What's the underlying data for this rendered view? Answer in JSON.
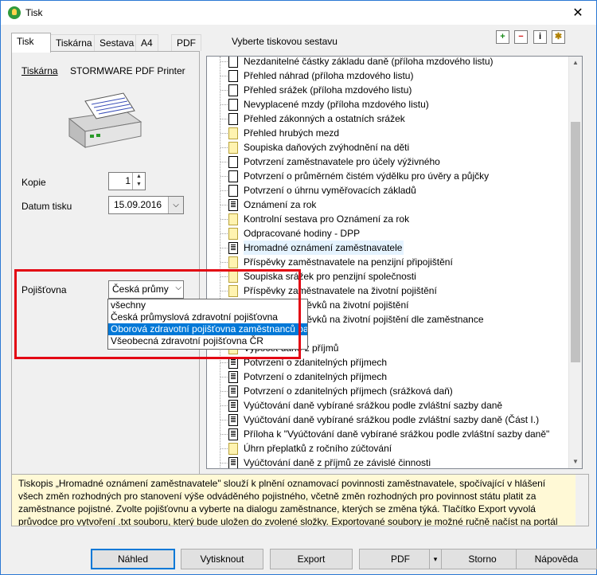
{
  "window": {
    "title": "Tisk",
    "close": "✕"
  },
  "tabs": [
    "Tisk",
    "Tiskárna",
    "Sestava",
    "A4",
    "PDF"
  ],
  "sestava_label": "Vyberte tiskovou sestavu",
  "toolbar_icons": [
    "add-icon",
    "remove-icon",
    "info-icon",
    "settings-icon"
  ],
  "left": {
    "printer_label": "Tiskárna",
    "printer_name": "STORMWARE PDF Printer",
    "kopie_label": "Kopie",
    "kopie_value": "1",
    "datum_label": "Datum tisku",
    "datum_value": "15.09.2016",
    "pojistovna_label": "Pojišťovna",
    "pojistovna_value": "Česká průmy",
    "dropdown": [
      "všechny",
      "Česká průmyslová zdravotní pojišťovna",
      "Oborová zdravotní pojišťovna zaměstnanců ba",
      "Všeobecná zdravotní pojišťovna ČR"
    ],
    "dropdown_selected": 2
  },
  "tree": [
    {
      "t": "Nezdanitelné částky základu daně (příloha mzdového listu)",
      "i": "doc"
    },
    {
      "t": "Přehled náhrad (příloha mzdového listu)",
      "i": "doc"
    },
    {
      "t": "Přehled srážek (příloha mzdového listu)",
      "i": "doc"
    },
    {
      "t": "Nevyplacené mzdy (příloha mzdového listu)",
      "i": "doc"
    },
    {
      "t": "Přehled zákonných a ostatních srážek",
      "i": "doc"
    },
    {
      "t": "Přehled hrubých mezd",
      "i": "folder"
    },
    {
      "t": "Soupiska daňových zvýhodnění na děti",
      "i": "folder"
    },
    {
      "t": "Potvrzení zaměstnavatele pro účely výživného",
      "i": "doc"
    },
    {
      "t": "Potvrzení o průměrném čistém výdělku pro úvěry a půjčky",
      "i": "doc"
    },
    {
      "t": "Potvrzení o úhrnu vyměřovacích základů",
      "i": "doc"
    },
    {
      "t": "Oznámení za rok",
      "i": "lines"
    },
    {
      "t": "Kontrolní sestava pro Oznámení za rok",
      "i": "folder"
    },
    {
      "t": "Odpracované hodiny - DPP",
      "i": "folder"
    },
    {
      "t": "Hromadné oznámení zaměstnavatele",
      "i": "lines",
      "hl": true
    },
    {
      "t": "Příspěvky zaměstnavatele na penzijní připojištění",
      "i": "folder"
    },
    {
      "t": "Soupiska srážek pro penzijní společnosti",
      "i": "folder"
    },
    {
      "t": "Příspěvky zaměstnavatele na životní pojištění",
      "i": "folder"
    },
    {
      "t": "Soupiska příspěvků na životní pojištění",
      "i": "folder"
    },
    {
      "t": "Soupiska příspěvků na životní pojištění dle zaměstnance",
      "i": "folder"
    },
    {
      "t": "",
      "i": "none"
    },
    {
      "t": "Výpočet daně z příjmů",
      "i": "folder"
    },
    {
      "t": "Potvrzení o zdanitelných příjmech",
      "i": "lines"
    },
    {
      "t": "Potvrzení o zdanitelných příjmech",
      "i": "lines"
    },
    {
      "t": "Potvrzení o zdanitelných příjmech (srážková daň)",
      "i": "lines"
    },
    {
      "t": "Vyúčtování daně vybírané srážkou podle zvláštní sazby daně",
      "i": "lines"
    },
    {
      "t": "Vyúčtování daně vybírané srážkou podle zvláštní sazby daně (Část I.)",
      "i": "lines"
    },
    {
      "t": "Příloha k \"Vyúčtování daně vybírané srážkou podle zvláštní sazby daně\"",
      "i": "lines"
    },
    {
      "t": "Úhrn přeplatků z ročního zúčtování",
      "i": "folder"
    },
    {
      "t": "Vyúčtování daně z příjmů ze závislé činnosti",
      "i": "lines"
    }
  ],
  "description": "Tiskopis „Hromadné oznámení zaměstnavatele\" slouží k plnění oznamovací povinnosti zaměstnavatele, spočívající v hlášení všech změn rozhodných pro stanovení výše odváděného pojistného, včetně změn rozhodných pro povinnost státu platit za zaměstnance pojistné. Zvolte pojišťovnu a vyberte na dialogu zaměstnance, kterých se změna týká. Tlačítko Export vyvolá průvodce pro vytvoření .txt souboru, který bude uložen do zvolené složky. Exportované soubory je možné ručně načíst na portál zdravotních",
  "buttons": {
    "nahled": "Náhled",
    "vytisknout": "Vytisknout",
    "export": "Export",
    "pdf": "PDF",
    "storno": "Storno",
    "napoveda": "Nápověda"
  }
}
